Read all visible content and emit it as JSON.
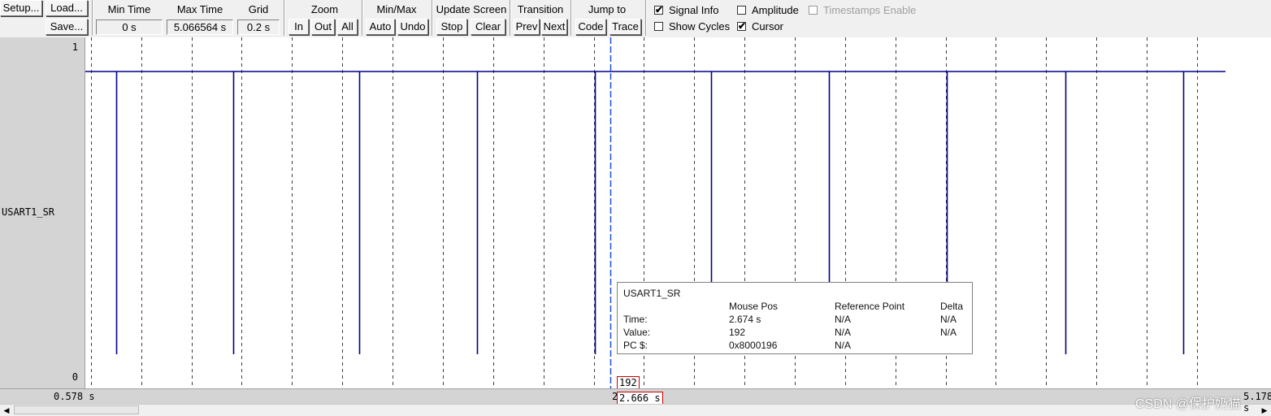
{
  "toolbar": {
    "setup_label": "Setup...",
    "load_label": "Load...",
    "save_label": "Save...",
    "min_time": {
      "title": "Min Time",
      "value": "0 s"
    },
    "max_time": {
      "title": "Max Time",
      "value": "5.066564 s"
    },
    "grid": {
      "title": "Grid",
      "value": "0.2 s"
    },
    "zoom": {
      "title": "Zoom",
      "in": "In",
      "out": "Out",
      "all": "All"
    },
    "minmax": {
      "title": "Min/Max",
      "auto": "Auto",
      "undo": "Undo"
    },
    "update_screen": {
      "title": "Update Screen",
      "stop": "Stop",
      "clear": "Clear"
    },
    "transition": {
      "title": "Transition",
      "prev": "Prev",
      "next": "Next"
    },
    "jump_to": {
      "title": "Jump to",
      "code": "Code",
      "trace": "Trace"
    },
    "checkboxes": {
      "signal_info": {
        "label": "Signal Info",
        "checked": true
      },
      "amplitude": {
        "label": "Amplitude",
        "checked": false
      },
      "timestamps_enable": {
        "label": "Timestamps Enable",
        "checked": false,
        "disabled": true
      },
      "show_cycles": {
        "label": "Show Cycles",
        "checked": false
      },
      "cursor": {
        "label": "Cursor",
        "checked": true
      }
    }
  },
  "signal": {
    "name": "USART1_SR",
    "max_label": "1",
    "min_label": "0",
    "color": "#00008b"
  },
  "waveform": {
    "view_start_s": 0.578,
    "view_end_s": 5.178,
    "grid_s": 0.2,
    "high_level": 1,
    "low_level": 0,
    "transitions_s": [
      0.7,
      1.166,
      1.666,
      2.136,
      2.606,
      3.066,
      3.536,
      4.006,
      4.476,
      4.946
    ]
  },
  "tooltip": {
    "title": "USART1_SR",
    "col_mouse": "Mouse Pos",
    "col_ref": "Reference Point",
    "col_delta": "Delta",
    "rows": [
      {
        "label": "Time:",
        "mouse": "2.674 s",
        "ref": "N/A",
        "delta": "N/A"
      },
      {
        "label": "Value:",
        "mouse": "192",
        "ref": "N/A",
        "delta": "N/A"
      },
      {
        "label": "PC $:",
        "mouse": "0x8000196",
        "ref": "N/A",
        "delta": ""
      }
    ]
  },
  "cursor": {
    "time_s": 2.666,
    "value_label": "192",
    "time_label": "2.666 s"
  },
  "axis": {
    "start_label": "0.578 s",
    "end_label": "5.178 s",
    "mid_fragment": "2"
  },
  "watermark": "CSDN @保护奶猫",
  "colors": {
    "grid": "#404040",
    "cursor": "#1f4fd8",
    "cursor_box_border": "#cc0000"
  }
}
